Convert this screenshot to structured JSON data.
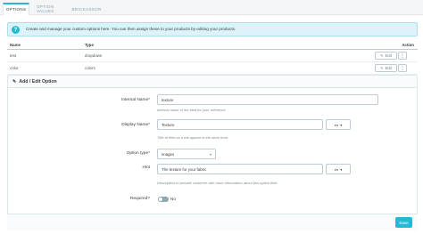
{
  "tabs": [
    {
      "label": "OPTIONS",
      "active": true
    },
    {
      "label": "OPTION VALUES",
      "active": false
    },
    {
      "label": "BRICKASSOR",
      "active": false
    }
  ],
  "alert": {
    "text": "Create and manage your custom options here. You can then assign these to your products by editing your products."
  },
  "table": {
    "headers": {
      "name": "Name",
      "type": "Type",
      "action": "Action"
    },
    "rows": [
      {
        "name": "test",
        "type": "dropdown",
        "edit": "Edit"
      },
      {
        "name": "color",
        "type": "colors",
        "edit": "Edit"
      }
    ]
  },
  "panel": {
    "title": "Add / Edit Option",
    "internal_name": {
      "label": "Internal Name*",
      "value": "texture",
      "help": "Internal name of the field for your reference"
    },
    "display_name": {
      "label": "Display Name*",
      "value": "Texture",
      "lang": "en",
      "help": "Title of field as it will appear in the store front"
    },
    "option_type": {
      "label": "Option type*",
      "value": "images"
    },
    "hint": {
      "label": "Hint",
      "value": "The texture for your fabric",
      "lang": "en",
      "help": "Description to provide customer with more information about this option field"
    },
    "required": {
      "label": "Required?",
      "value": "No"
    }
  },
  "buttons": {
    "save": "Save"
  },
  "colors": {
    "accent": "#25b9d7",
    "alert_bg": "#dcf4f9"
  }
}
